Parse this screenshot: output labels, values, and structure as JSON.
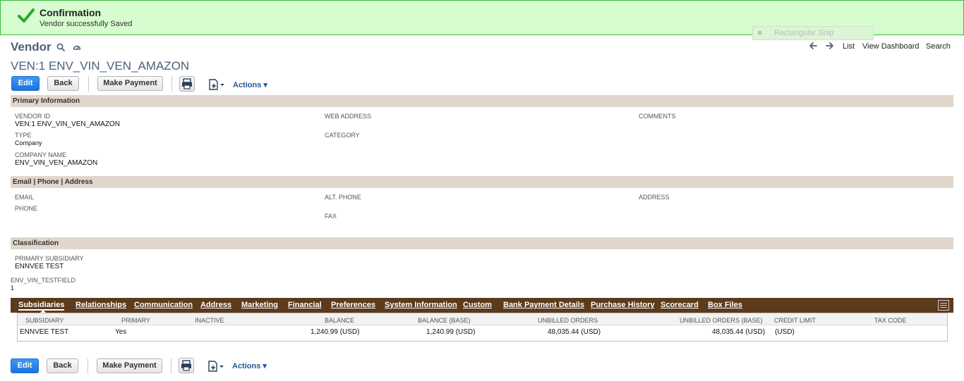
{
  "banner": {
    "title": "Confirmation",
    "message": "Vendor successfully Saved",
    "overlay_label": "Rectangular Snip",
    "color_success": "#3cb83c"
  },
  "header": {
    "title": "Vendor",
    "record_name": "VEN:1 ENV_VIN_VEN_AMAZON",
    "nav": {
      "list": "List",
      "view_dashboard": "View Dashboard",
      "search": "Search"
    }
  },
  "toolbar": {
    "edit": "Edit",
    "back": "Back",
    "make_payment": "Make Payment",
    "actions": "Actions"
  },
  "sections": {
    "primary": {
      "title": "Primary Information",
      "vendor_id_label": "VENDOR ID",
      "vendor_id_value": "VEN:1 ENV_VIN_VEN_AMAZON",
      "type_label": "TYPE",
      "type_value": "Company",
      "company_name_label": "COMPANY NAME",
      "company_name_value": "ENV_VIN_VEN_AMAZON",
      "web_address_label": "WEB ADDRESS",
      "category_label": "CATEGORY",
      "comments_label": "COMMENTS"
    },
    "contact": {
      "title": "Email | Phone | Address",
      "email_label": "EMAIL",
      "phone_label": "PHONE",
      "alt_phone_label": "ALT. PHONE",
      "fax_label": "FAX",
      "address_label": "ADDRESS"
    },
    "classification": {
      "title": "Classification",
      "primary_subsidiary_label": "PRIMARY SUBSIDIARY",
      "primary_subsidiary_value": "ENNVEE TEST"
    },
    "custom_field": {
      "label": "ENV_VIN_TESTFIELD",
      "value": "1"
    }
  },
  "tabs": [
    "Subsidiaries",
    "Relationships",
    "Communication",
    "Address",
    "Marketing",
    "Financial",
    "Preferences",
    "System Information",
    "Custom",
    "Bank Payment Details",
    "Purchase History",
    "Scorecard",
    "Box Files"
  ],
  "sublist": {
    "columns": [
      "SUBSIDIARY",
      "PRIMARY",
      "INACTIVE",
      "BALANCE",
      "BALANCE (BASE)",
      "UNBILLED ORDERS",
      "UNBILLED ORDERS (BASE)",
      "CREDIT LIMIT",
      "TAX CODE"
    ],
    "rows": [
      {
        "subsidiary": "ENNVEE TEST",
        "primary": "Yes",
        "inactive": "",
        "balance": "1,240.99  (USD)",
        "balance_base": "1,240.99  (USD)",
        "unbilled_orders": "48,035.44  (USD)",
        "unbilled_orders_base": "48,035.44  (USD)",
        "credit_limit": "(USD)",
        "tax_code": ""
      }
    ]
  }
}
